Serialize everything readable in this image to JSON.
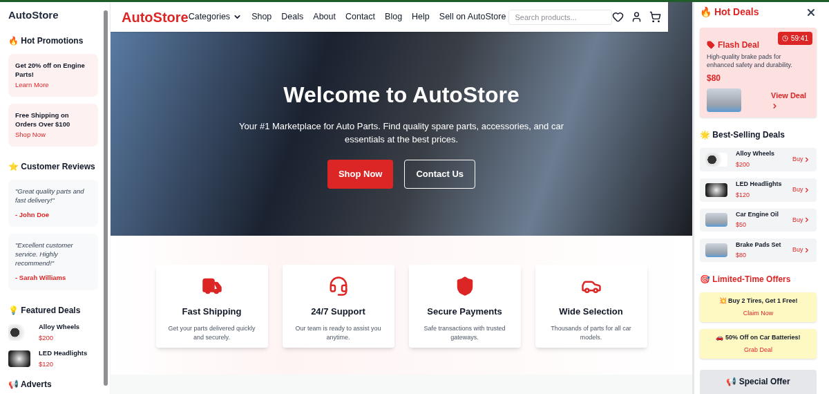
{
  "sidebar": {
    "title": "AutoStore",
    "promotions": {
      "heading": "🔥 Hot Promotions",
      "items": [
        {
          "text": "Get 20% off on Engine Parts!",
          "link": "Learn More"
        },
        {
          "text": "Free Shipping on Orders Over $100",
          "link": "Shop Now"
        }
      ]
    },
    "reviews": {
      "heading": "⭐ Customer Reviews",
      "items": [
        {
          "quote": "\"Great quality parts and fast delivery!\"",
          "author": "- John Doe"
        },
        {
          "quote": "\"Excellent customer service. Highly recommend!\"",
          "author": "- Sarah Williams"
        }
      ]
    },
    "featured": {
      "heading": "💡 Featured Deals",
      "items": [
        {
          "name": "Alloy Wheels",
          "price": "$200",
          "kind": "wheels"
        },
        {
          "name": "LED Headlights",
          "price": "$120",
          "kind": "headlights"
        }
      ]
    },
    "adverts": {
      "heading": "📢 Adverts"
    }
  },
  "nav": {
    "logo": "AutoStore",
    "links": [
      "Categories",
      "Shop",
      "Deals",
      "About",
      "Contact",
      "Blog",
      "Help",
      "Sell on AutoStore"
    ],
    "search": {
      "placeholder": "Search products..."
    }
  },
  "hero": {
    "title": "Welcome to AutoStore",
    "subtitle": "Your #1 Marketplace for Auto Parts. Find quality spare parts, accessories, and car essentials at the best prices.",
    "buttons": [
      {
        "label": "Shop Now",
        "kind": "primary"
      },
      {
        "label": "Contact Us",
        "kind": "outline"
      }
    ]
  },
  "features": [
    {
      "kind": "truck",
      "title": "Fast Shipping",
      "text": "Get your parts delivered quickly and securely."
    },
    {
      "kind": "headset",
      "title": "24/7 Support",
      "text": "Our team is ready to assist you anytime."
    },
    {
      "kind": "shield",
      "title": "Secure Payments",
      "text": "Safe transactions with trusted gateways."
    },
    {
      "kind": "car",
      "title": "Wide Selection",
      "text": "Thousands of parts for all car models."
    }
  ],
  "panel": {
    "title": "🔥 Hot Deals",
    "flash": {
      "title": "Flash Deal",
      "timer": "59:41",
      "text": "High-quality brake pads for enhanced safety and durability.",
      "price": "$80",
      "link": "View Deal"
    },
    "best": {
      "heading": "🌟 Best-Selling Deals",
      "items": [
        {
          "name": "Alloy Wheels",
          "price": "$200",
          "action": "Buy",
          "kind": "wheels"
        },
        {
          "name": "LED Headlights",
          "price": "$120",
          "action": "Buy",
          "kind": "headlights"
        },
        {
          "name": "Car Engine Oil",
          "price": "$50",
          "action": "Buy",
          "kind": "parts"
        },
        {
          "name": "Brake Pads Set",
          "price": "$80",
          "action": "Buy",
          "kind": "parts"
        }
      ]
    },
    "offers": {
      "heading": "🎯 Limited-Time Offers",
      "items": [
        {
          "text": "💥 Buy 2 Tires, Get 1 Free!",
          "link": "Claim Now"
        },
        {
          "text": "🚗 50% Off on Car Batteries!",
          "link": "Grab Deal"
        }
      ]
    },
    "special": {
      "title": "📢 Special Offer"
    }
  }
}
